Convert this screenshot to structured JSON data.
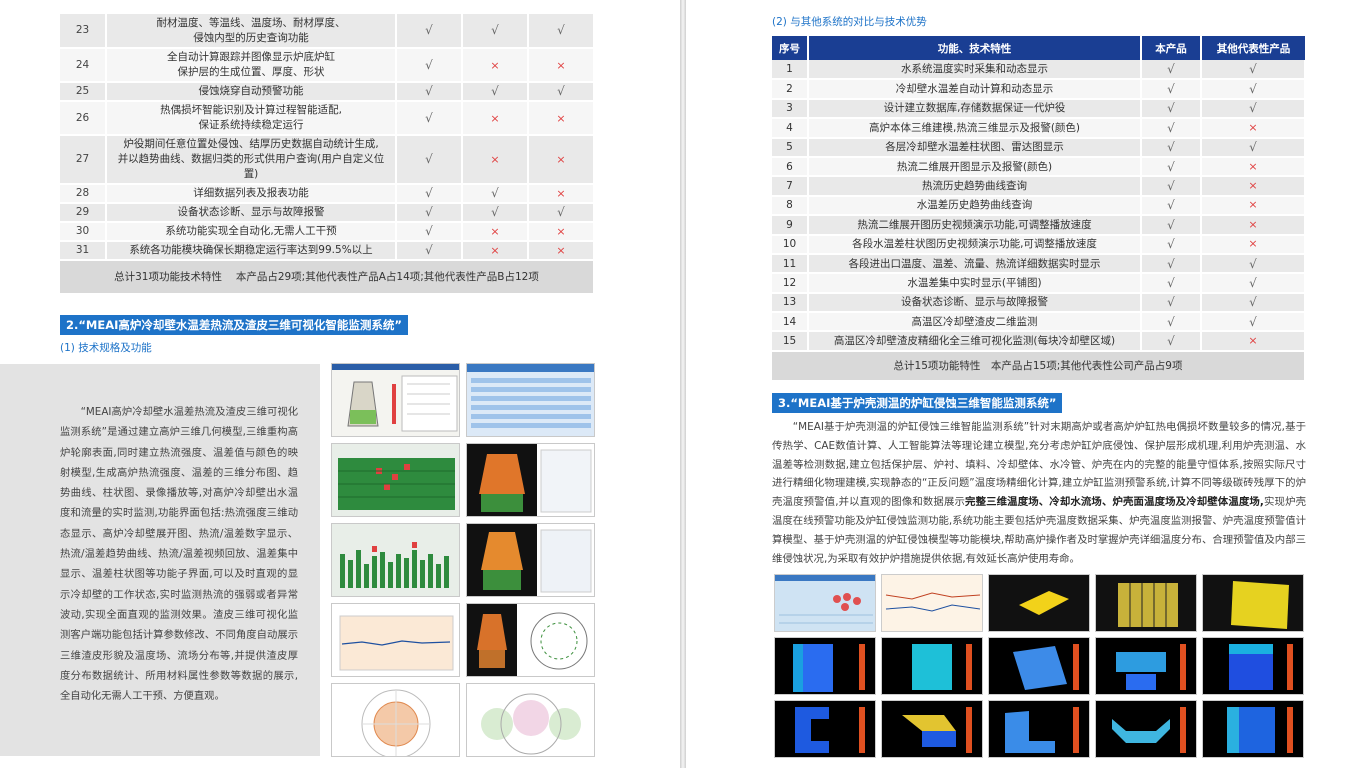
{
  "left_table": {
    "rows": [
      {
        "no": "23",
        "text": [
          "耐材温度、等温线、温度场、耐材厚度、",
          "侵蚀内型的历史查询功能"
        ],
        "marks": [
          "√",
          "√",
          "√"
        ]
      },
      {
        "no": "24",
        "text": [
          "全自动计算跟踪并图像显示炉底炉缸",
          "保护层的生成位置、厚度、形状"
        ],
        "marks": [
          "√",
          "×",
          "×"
        ]
      },
      {
        "no": "25",
        "text": [
          "侵蚀烧穿自动预警功能"
        ],
        "marks": [
          "√",
          "√",
          "√"
        ]
      },
      {
        "no": "26",
        "text": [
          "热偶损坏智能识别及计算过程智能适配,",
          "保证系统持续稳定运行"
        ],
        "marks": [
          "√",
          "×",
          "×"
        ]
      },
      {
        "no": "27",
        "text": [
          "炉役期间任意位置处侵蚀、结厚历史数据自动统计生成,",
          "并以趋势曲线、数据归类的形式供用户查询(用户自定义位置)"
        ],
        "marks": [
          "√",
          "×",
          "×"
        ]
      },
      {
        "no": "28",
        "text": [
          "详细数据列表及报表功能"
        ],
        "marks": [
          "√",
          "√",
          "×"
        ]
      },
      {
        "no": "29",
        "text": [
          "设备状态诊断、显示与故障报警"
        ],
        "marks": [
          "√",
          "√",
          "√"
        ]
      },
      {
        "no": "30",
        "text": [
          "系统功能实现全自动化,无需人工干预"
        ],
        "marks": [
          "√",
          "×",
          "×"
        ]
      },
      {
        "no": "31",
        "text": [
          "系统各功能模块确保长期稳定运行率达到99.5%以上"
        ],
        "marks": [
          "√",
          "×",
          "×"
        ]
      }
    ],
    "summary": "总计31项功能技术特性　 本产品占29项;其他代表性产品A占14项;其他代表性产品B占12项"
  },
  "section2": {
    "title": "2.“MEAI高炉冷却壁水温差热流及渣皮三维可视化智能监测系统”",
    "subtitle": "(1) 技术规格及功能",
    "intro": "“MEAI高炉冷却壁水温差热流及渣皮三维可视化监测系统”是通过建立高炉三维几何模型,三维重构高炉轮廓表面,同时建立热流强度、温差值与颜色的映射模型,生成高炉热流强度、温差的三维分布图、趋势曲线、柱状图、录像播放等,对高炉冷却壁出水温度和流量的实时监测,功能界面包括:热流强度三维动态显示、高炉冷却壁展开图、热流/温差数字显示、热流/温差趋势曲线、热流/温差视频回放、温差集中显示、温差柱状图等功能子界面,可以及时直观的显示冷却壁的工作状态,实时监测热流的强弱或者异常波动,实现全面直观的监测效果。渣皮三维可视化监测客户端功能包括计算参数修改、不同角度自动展示三维渣皮形貌及温度场、流场分布等,并提供渣皮厚度分布数据统计、所用材料属性参数等数据的展示,全自动化无需人工干预、方便直观。"
  },
  "right_top": {
    "subtitle": "(2) 与其他系统的对比与技术优势",
    "headers": [
      "序号",
      "功能、技术特性",
      "本产品",
      "其他代表性产品"
    ],
    "rows": [
      {
        "no": "1",
        "text": "水系统温度实时采集和动态显示",
        "a": "√",
        "b": "√"
      },
      {
        "no": "2",
        "text": "冷却壁水温差自动计算和动态显示",
        "a": "√",
        "b": "√"
      },
      {
        "no": "3",
        "text": "设计建立数据库,存储数据保证一代炉役",
        "a": "√",
        "b": "√"
      },
      {
        "no": "4",
        "text": "高炉本体三维建模,热流三维显示及报警(颜色)",
        "a": "√",
        "b": "×"
      },
      {
        "no": "5",
        "text": "各层冷却壁水温差柱状图、雷达图显示",
        "a": "√",
        "b": "√"
      },
      {
        "no": "6",
        "text": "热流二维展开图显示及报警(颜色)",
        "a": "√",
        "b": "×"
      },
      {
        "no": "7",
        "text": "热流历史趋势曲线查询",
        "a": "√",
        "b": "×"
      },
      {
        "no": "8",
        "text": "水温差历史趋势曲线查询",
        "a": "√",
        "b": "×"
      },
      {
        "no": "9",
        "text": "热流二维展开图历史视频演示功能,可调整播放速度",
        "a": "√",
        "b": "×"
      },
      {
        "no": "10",
        "text": "各段水温差柱状图历史视频演示功能,可调整播放速度",
        "a": "√",
        "b": "×"
      },
      {
        "no": "11",
        "text": "各段进出口温度、温差、流量、热流详细数据实时显示",
        "a": "√",
        "b": "√"
      },
      {
        "no": "12",
        "text": "水温差集中实时显示(平铺图)",
        "a": "√",
        "b": "√"
      },
      {
        "no": "13",
        "text": "设备状态诊断、显示与故障报警",
        "a": "√",
        "b": "√"
      },
      {
        "no": "14",
        "text": "高温区冷却壁渣皮二维监测",
        "a": "√",
        "b": "√"
      },
      {
        "no": "15",
        "text": "高温区冷却壁渣皮精细化全三维可视化监测(每块冷却壁区域)",
        "a": "√",
        "b": "×"
      }
    ],
    "summary": "总计15项功能特性　本产品占15项;其他代表性公司产品占9项"
  },
  "section3": {
    "title": "3.“MEAI基于炉壳测温的炉缸侵蚀三维智能监测系统”",
    "para_a": "“MEAI基于炉壳测温的炉缸侵蚀三维智能监测系统”针对末期高炉或者高炉炉缸热电偶损坏数量较多的情况,基于传热学、CAE数值计算、人工智能算法等理论建立模型,充分考虑炉缸炉底侵蚀、保护层形成机理,利用炉壳测温、水温差等检测数据,建立包括保护层、炉衬、填料、冷却壁体、水冷管、炉壳在内的完整的能量守恒体系,按照实际尺寸进行精细化物理建模,实现静态的“正反问题”温度场精细化计算,建立炉缸监测预警系统,计算不同等级碳砖残厚下的炉壳温度预警值,并以直观的图像和数据展示",
    "para_bold": "完整三维温度场、冷却水流场、炉壳面温度场及冷却壁体温度场,",
    "para_b": "实现炉壳温度在线预警功能及炉缸侵蚀监测功能,系统功能主要包括炉壳温度数据采集、炉壳温度监测报警、炉壳温度预警值计算模型、基于炉壳测温的炉缸侵蚀模型等功能模块,帮助高炉操作者及时掌握炉壳详细温度分布、合理预警值及内部三维侵蚀状况,为采取有效护炉措施提供依据,有效延长高炉使用寿命。"
  },
  "colors": {
    "blue_band": "#1e73c8",
    "header_navy": "#1a3e93",
    "cross": "#e04040",
    "check": "#666666"
  }
}
